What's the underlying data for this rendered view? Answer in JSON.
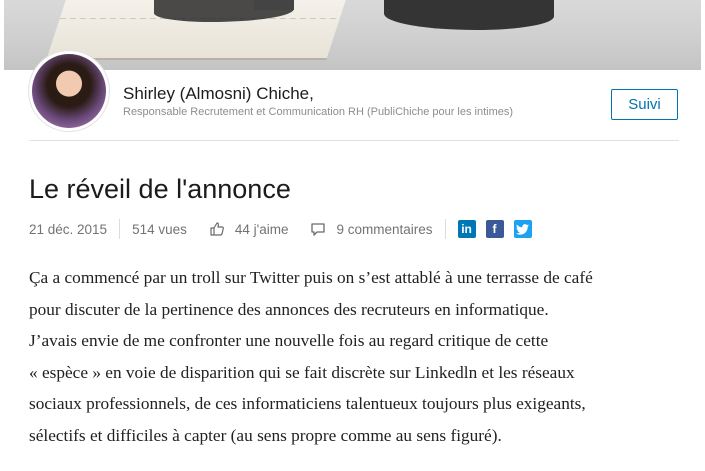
{
  "author": {
    "name": "Shirley (Almosni) Chiche,",
    "title": "Responsable Recrutement et Communication RH (PubliChiche pour les intimes)",
    "follow_label": "Suivi"
  },
  "article": {
    "title": "Le réveil de l'annonce",
    "date": "21 déc. 2015",
    "views": "514 vues",
    "likes": "44 j'aime",
    "comments": "9 commentaires",
    "body_lines": [
      "Ça a commencé par un troll sur Twitter puis on s’est attablé à une terrasse de café",
      "pour discuter de la pertinence des annonces des recruteurs en informatique.",
      "J’avais envie de me confronter une nouvelle fois au regard critique de cette",
      "« espèce » en voie de disparition qui se fait discrète sur Linkedln et les réseaux",
      "sociaux professionnels, de ces informaticiens talentueux toujours plus exigeants,",
      "sélectifs et difficiles à capter (au sens propre comme au sens figuré)."
    ]
  },
  "social": {
    "linkedin": "in",
    "facebook": "f",
    "twitter": "twitter-bird-icon"
  },
  "colors": {
    "brand": "#0073b1",
    "linkedin": "#0077b5",
    "facebook": "#3b5998",
    "twitter": "#1da1f2"
  }
}
